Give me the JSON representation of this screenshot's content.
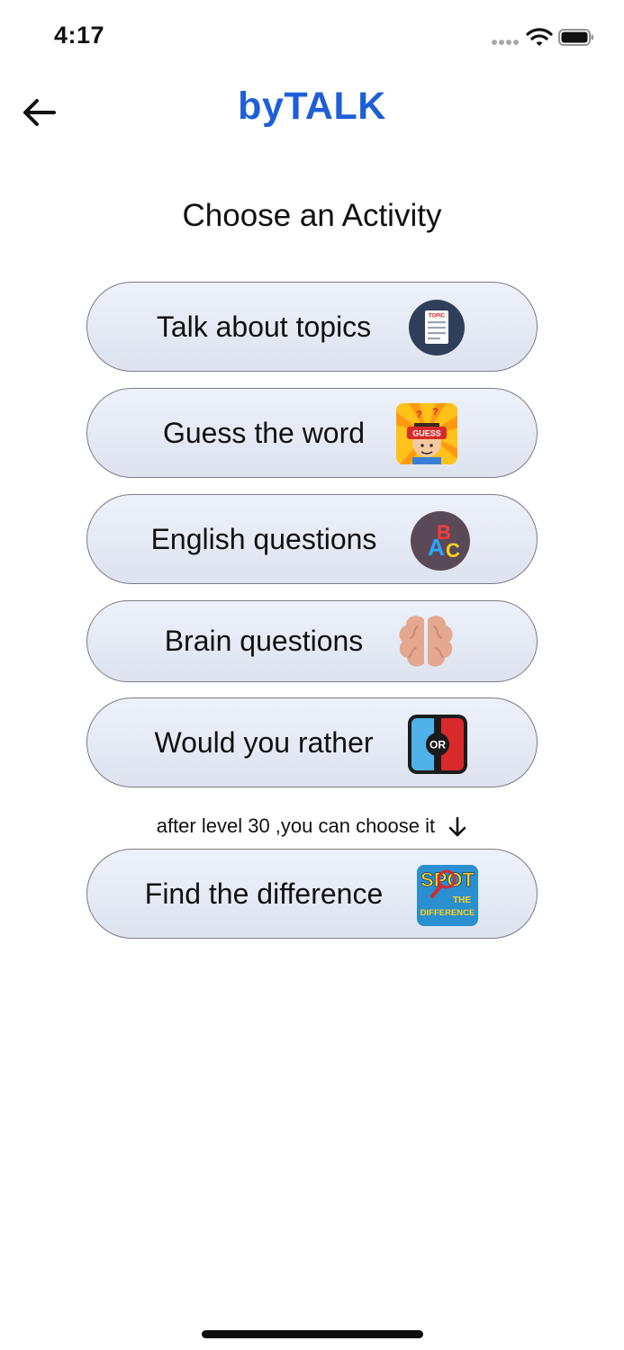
{
  "status_bar": {
    "time": "4:17"
  },
  "header": {
    "title": "byTALK",
    "back_icon": "arrow-left-icon"
  },
  "subtitle": "Choose an Activity",
  "activities": [
    {
      "label": "Talk about topics",
      "icon": "topic-list-icon"
    },
    {
      "label": "Guess the word",
      "icon": "guess-card-icon"
    },
    {
      "label": "English questions",
      "icon": "abc-letters-icon"
    },
    {
      "label": "Brain questions",
      "icon": "brain-icon"
    },
    {
      "label": "Would you rather",
      "icon": "or-choice-icon"
    },
    {
      "label": "Find the difference",
      "icon": "spot-the-difference-icon"
    }
  ],
  "level_note": "after level 30 ,you can choose it",
  "icon_texts": {
    "topic": "TOPIC",
    "guess": "GUESS",
    "abc_a": "A",
    "abc_b": "B",
    "abc_c": "C",
    "or": "OR",
    "spot": "SPOT",
    "the": "THE",
    "difference": "DIFFERENCE"
  },
  "colors": {
    "title_blue": "#1f5fd6",
    "button_gradient_top": "#edf1fa",
    "button_gradient_bottom": "#dde3ef",
    "button_border": "#7c7c84"
  }
}
